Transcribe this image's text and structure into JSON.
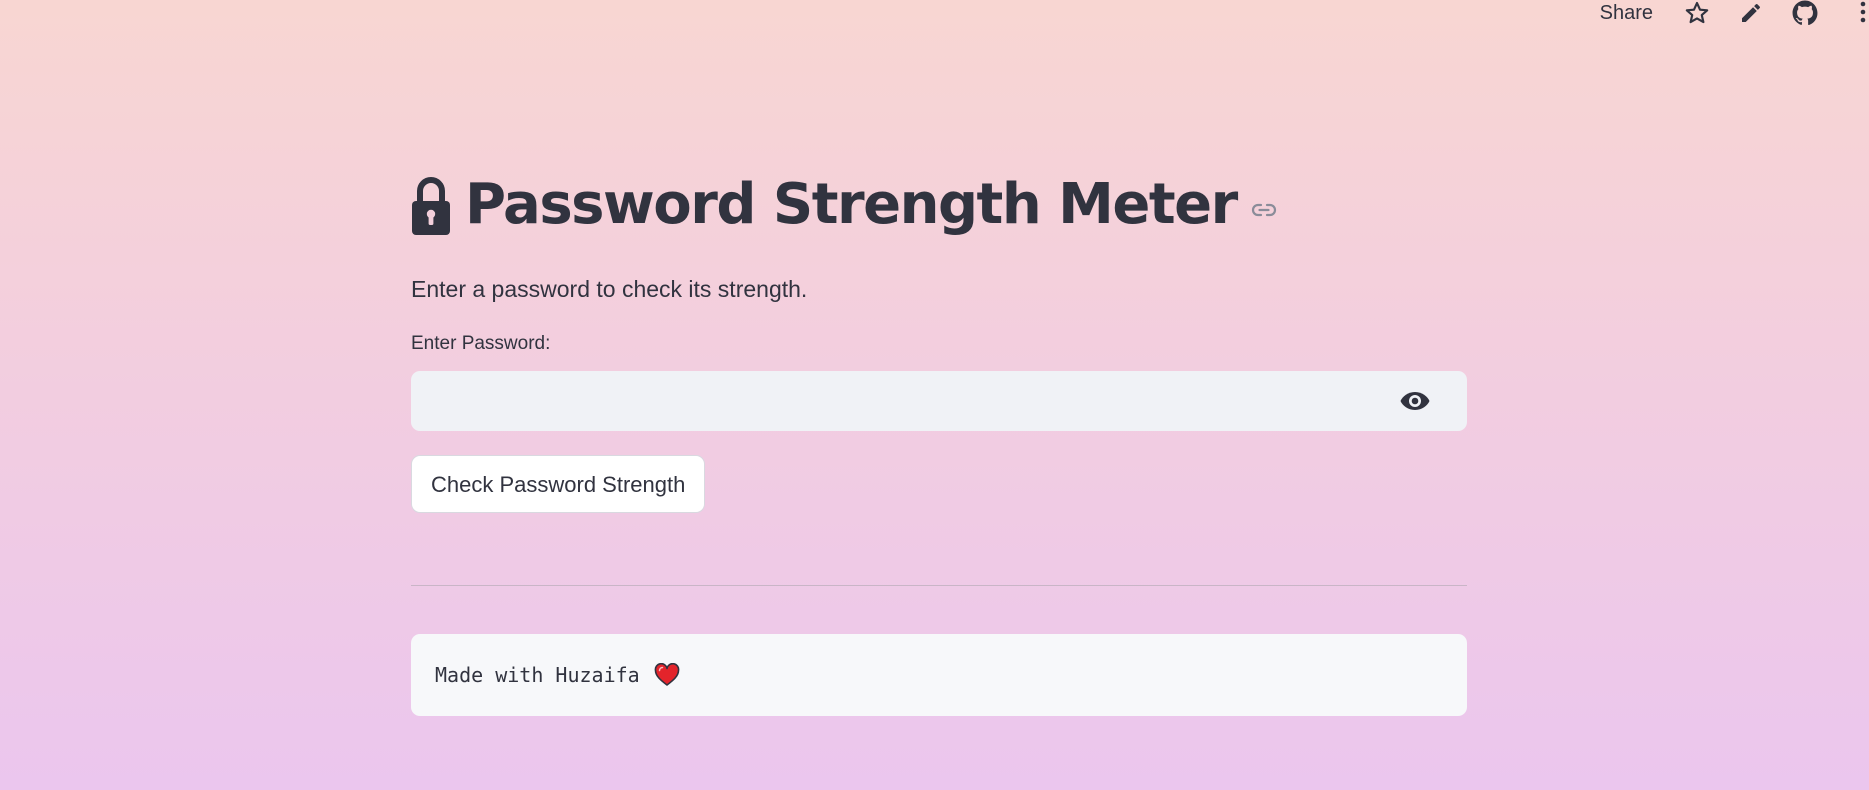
{
  "toolbar": {
    "share_label": "Share",
    "icons": [
      "star-icon",
      "pencil-icon",
      "github-icon",
      "more-vert-icon"
    ]
  },
  "header": {
    "title_icon": "lock-icon",
    "title": "Password Strength Meter",
    "anchor_icon": "link-icon"
  },
  "main": {
    "subtitle": "Enter a password to check its strength.",
    "password_field": {
      "label": "Enter Password:",
      "value": "",
      "placeholder": "",
      "toggle_icon": "eye-icon"
    },
    "check_button_label": "Check Password Strength",
    "footer": {
      "text": "Made with Huzaifa",
      "emoji_icon": "heart-icon"
    }
  },
  "colors": {
    "text": "#31333f",
    "input_bg": "#f0f2f6",
    "code_bg": "#f7f8fa",
    "heart": "#e3242b",
    "bg_top": "#f8d6d2",
    "bg_bottom": "#ebc6ee"
  }
}
